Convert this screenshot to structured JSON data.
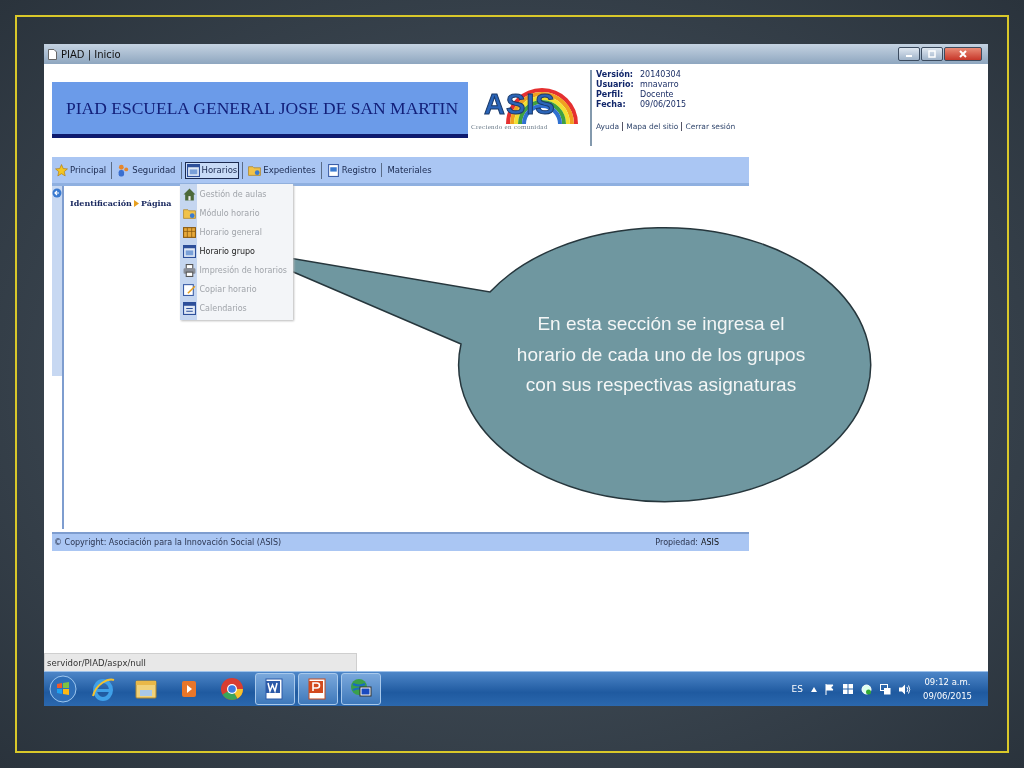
{
  "window": {
    "title": "PIAD | Inicio"
  },
  "header": {
    "title": "PIAD ESCUELA GENERAL JOSE DE SAN MARTIN",
    "logo": {
      "name": "ASIS",
      "tagline": "Creciendo en comunidad"
    },
    "info": [
      {
        "label": "Versión:",
        "value": "20140304"
      },
      {
        "label": "Usuario:",
        "value": "mnavarro"
      },
      {
        "label": "Perfil:",
        "value": "Docente"
      },
      {
        "label": "Fecha:",
        "value": "09/06/2015"
      }
    ],
    "links": [
      "Ayuda",
      "Mapa del sitio",
      "Cerrar sesión"
    ]
  },
  "menu": [
    {
      "label": "Principal",
      "selected": false
    },
    {
      "label": "Seguridad",
      "selected": false
    },
    {
      "label": "Horarios",
      "selected": true
    },
    {
      "label": "Expedientes",
      "selected": false
    },
    {
      "label": "Registro",
      "selected": false
    },
    {
      "label": "Materiales",
      "selected": false
    }
  ],
  "dropdown": [
    {
      "label": "Gestión de aulas",
      "disabled": true
    },
    {
      "label": "Módulo horario",
      "disabled": true
    },
    {
      "label": "Horario general",
      "disabled": true
    },
    {
      "label": "Horario grupo",
      "disabled": false
    },
    {
      "label": "Impresión de horarios",
      "disabled": true
    },
    {
      "label": "Copiar horario",
      "disabled": true
    },
    {
      "label": "Calendarios",
      "disabled": true
    }
  ],
  "breadcrumb": [
    "Identificación",
    "Página"
  ],
  "footer": {
    "copyright": "© Copyright: Asociación para la Innovación Social (ASIS)",
    "property_label": "Propiedad:",
    "property_value": "ASIS"
  },
  "status_url": "servidor/PIAD/aspx/null",
  "callout": "En esta sección se ingresa el horario de cada uno de los grupos con sus respectivas asignaturas",
  "taskbar": {
    "apps": [
      {
        "active": false
      },
      {
        "active": false
      },
      {
        "active": false
      },
      {
        "active": false
      },
      {
        "active": true
      },
      {
        "active": true
      },
      {
        "active": true
      }
    ],
    "language": "ES",
    "time": "09:12 a.m.",
    "date": "09/06/2015"
  }
}
